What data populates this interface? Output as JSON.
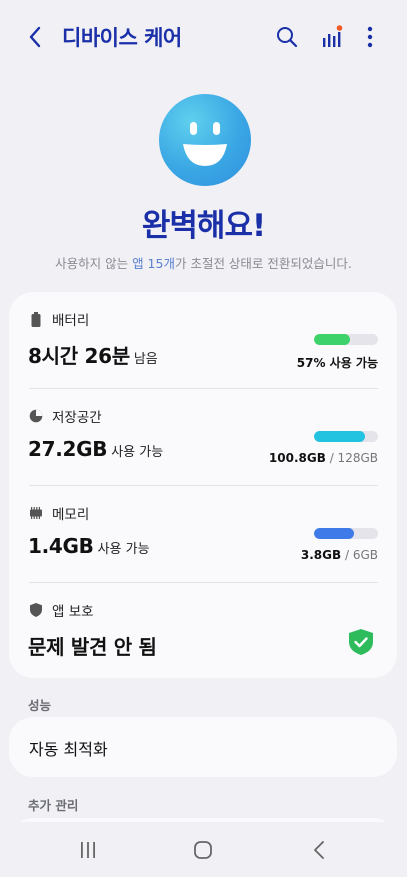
{
  "header": {
    "title": "디바이스 케어",
    "back_icon": "chevron-left-icon",
    "search_icon": "search-icon",
    "stats_icon": "bar-chart-icon",
    "more_icon": "more-vertical-icon",
    "notification_dot_color": "#f15a24"
  },
  "hero": {
    "face_icon": "smiley-face-icon",
    "title": "완벽해요!",
    "subtitle_prefix": "사용하지 않는 ",
    "subtitle_highlight": "앱 15개",
    "subtitle_suffix": "가 초절전 상태로 전환되었습니다."
  },
  "status_card": {
    "battery": {
      "icon": "battery-icon",
      "label": "배터리",
      "value": "8시간 26분",
      "value_unit": "남음",
      "percent_label": "57% 사용 가능",
      "level": 0.57,
      "color": "#3ed36a"
    },
    "storage": {
      "icon": "pie-chart-icon",
      "label": "저장공간",
      "value": "27.2GB",
      "value_unit": "사용 가능",
      "used": "100.8GB",
      "total": "/ 128GB",
      "level": 0.79,
      "color": "#22c3e0"
    },
    "memory": {
      "icon": "memory-chip-icon",
      "label": "메모리",
      "value": "1.4GB",
      "value_unit": "사용 가능",
      "used": "3.8GB",
      "total": "/ 6GB",
      "level": 0.63,
      "color": "#3e7be8"
    },
    "app_protection": {
      "icon": "shield-icon",
      "label": "앱 보호",
      "value": "문제 발견 안 됨",
      "status_icon": "shield-check-icon",
      "status_color": "#2dbb5c"
    }
  },
  "sections": {
    "performance_label": "성능",
    "auto_optimize": "자동 최적화",
    "extra_label": "추가 관리"
  },
  "navbar": {
    "recents_icon": "recents-icon",
    "home_icon": "home-icon",
    "back_icon": "back-icon"
  }
}
